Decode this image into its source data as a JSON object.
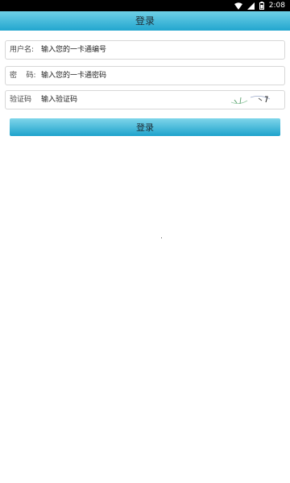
{
  "status_bar": {
    "time": "2:08",
    "icons": [
      "wifi-icon",
      "signal-icon",
      "battery-icon"
    ]
  },
  "header": {
    "title": "登录"
  },
  "form": {
    "username": {
      "label": "用户名:",
      "placeholder": "输入您的一卡通编号",
      "value": ""
    },
    "password": {
      "label": "密    码:",
      "placeholder": "输入您的一卡通密码",
      "value": ""
    },
    "captcha": {
      "label": "验证码",
      "placeholder": "输入验证码",
      "value": ""
    },
    "submit_label": "登录"
  },
  "colors": {
    "header_gradient_top": "#6fd0e6",
    "header_gradient_bottom": "#22a6cf",
    "button_gradient_top": "#7fd5ea",
    "button_gradient_bottom": "#1ea3cc",
    "status_bar": "#000000"
  }
}
